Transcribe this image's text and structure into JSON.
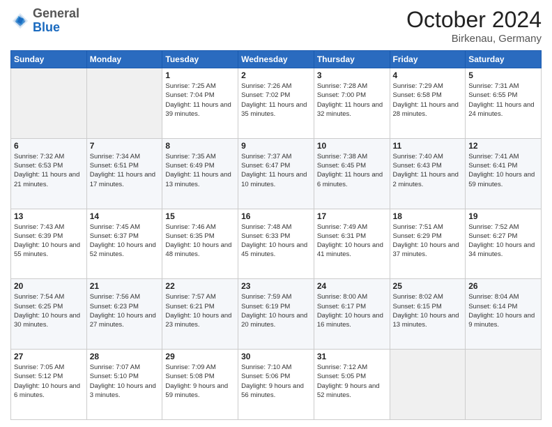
{
  "header": {
    "logo": {
      "line1": "General",
      "line2": "Blue"
    },
    "title": "October 2024",
    "location": "Birkenau, Germany"
  },
  "weekdays": [
    "Sunday",
    "Monday",
    "Tuesday",
    "Wednesday",
    "Thursday",
    "Friday",
    "Saturday"
  ],
  "weeks": [
    [
      {
        "day": "",
        "info": ""
      },
      {
        "day": "",
        "info": ""
      },
      {
        "day": "1",
        "info": "Sunrise: 7:25 AM\nSunset: 7:04 PM\nDaylight: 11 hours and 39 minutes."
      },
      {
        "day": "2",
        "info": "Sunrise: 7:26 AM\nSunset: 7:02 PM\nDaylight: 11 hours and 35 minutes."
      },
      {
        "day": "3",
        "info": "Sunrise: 7:28 AM\nSunset: 7:00 PM\nDaylight: 11 hours and 32 minutes."
      },
      {
        "day": "4",
        "info": "Sunrise: 7:29 AM\nSunset: 6:58 PM\nDaylight: 11 hours and 28 minutes."
      },
      {
        "day": "5",
        "info": "Sunrise: 7:31 AM\nSunset: 6:55 PM\nDaylight: 11 hours and 24 minutes."
      }
    ],
    [
      {
        "day": "6",
        "info": "Sunrise: 7:32 AM\nSunset: 6:53 PM\nDaylight: 11 hours and 21 minutes."
      },
      {
        "day": "7",
        "info": "Sunrise: 7:34 AM\nSunset: 6:51 PM\nDaylight: 11 hours and 17 minutes."
      },
      {
        "day": "8",
        "info": "Sunrise: 7:35 AM\nSunset: 6:49 PM\nDaylight: 11 hours and 13 minutes."
      },
      {
        "day": "9",
        "info": "Sunrise: 7:37 AM\nSunset: 6:47 PM\nDaylight: 11 hours and 10 minutes."
      },
      {
        "day": "10",
        "info": "Sunrise: 7:38 AM\nSunset: 6:45 PM\nDaylight: 11 hours and 6 minutes."
      },
      {
        "day": "11",
        "info": "Sunrise: 7:40 AM\nSunset: 6:43 PM\nDaylight: 11 hours and 2 minutes."
      },
      {
        "day": "12",
        "info": "Sunrise: 7:41 AM\nSunset: 6:41 PM\nDaylight: 10 hours and 59 minutes."
      }
    ],
    [
      {
        "day": "13",
        "info": "Sunrise: 7:43 AM\nSunset: 6:39 PM\nDaylight: 10 hours and 55 minutes."
      },
      {
        "day": "14",
        "info": "Sunrise: 7:45 AM\nSunset: 6:37 PM\nDaylight: 10 hours and 52 minutes."
      },
      {
        "day": "15",
        "info": "Sunrise: 7:46 AM\nSunset: 6:35 PM\nDaylight: 10 hours and 48 minutes."
      },
      {
        "day": "16",
        "info": "Sunrise: 7:48 AM\nSunset: 6:33 PM\nDaylight: 10 hours and 45 minutes."
      },
      {
        "day": "17",
        "info": "Sunrise: 7:49 AM\nSunset: 6:31 PM\nDaylight: 10 hours and 41 minutes."
      },
      {
        "day": "18",
        "info": "Sunrise: 7:51 AM\nSunset: 6:29 PM\nDaylight: 10 hours and 37 minutes."
      },
      {
        "day": "19",
        "info": "Sunrise: 7:52 AM\nSunset: 6:27 PM\nDaylight: 10 hours and 34 minutes."
      }
    ],
    [
      {
        "day": "20",
        "info": "Sunrise: 7:54 AM\nSunset: 6:25 PM\nDaylight: 10 hours and 30 minutes."
      },
      {
        "day": "21",
        "info": "Sunrise: 7:56 AM\nSunset: 6:23 PM\nDaylight: 10 hours and 27 minutes."
      },
      {
        "day": "22",
        "info": "Sunrise: 7:57 AM\nSunset: 6:21 PM\nDaylight: 10 hours and 23 minutes."
      },
      {
        "day": "23",
        "info": "Sunrise: 7:59 AM\nSunset: 6:19 PM\nDaylight: 10 hours and 20 minutes."
      },
      {
        "day": "24",
        "info": "Sunrise: 8:00 AM\nSunset: 6:17 PM\nDaylight: 10 hours and 16 minutes."
      },
      {
        "day": "25",
        "info": "Sunrise: 8:02 AM\nSunset: 6:15 PM\nDaylight: 10 hours and 13 minutes."
      },
      {
        "day": "26",
        "info": "Sunrise: 8:04 AM\nSunset: 6:14 PM\nDaylight: 10 hours and 9 minutes."
      }
    ],
    [
      {
        "day": "27",
        "info": "Sunrise: 7:05 AM\nSunset: 5:12 PM\nDaylight: 10 hours and 6 minutes."
      },
      {
        "day": "28",
        "info": "Sunrise: 7:07 AM\nSunset: 5:10 PM\nDaylight: 10 hours and 3 minutes."
      },
      {
        "day": "29",
        "info": "Sunrise: 7:09 AM\nSunset: 5:08 PM\nDaylight: 9 hours and 59 minutes."
      },
      {
        "day": "30",
        "info": "Sunrise: 7:10 AM\nSunset: 5:06 PM\nDaylight: 9 hours and 56 minutes."
      },
      {
        "day": "31",
        "info": "Sunrise: 7:12 AM\nSunset: 5:05 PM\nDaylight: 9 hours and 52 minutes."
      },
      {
        "day": "",
        "info": ""
      },
      {
        "day": "",
        "info": ""
      }
    ]
  ]
}
